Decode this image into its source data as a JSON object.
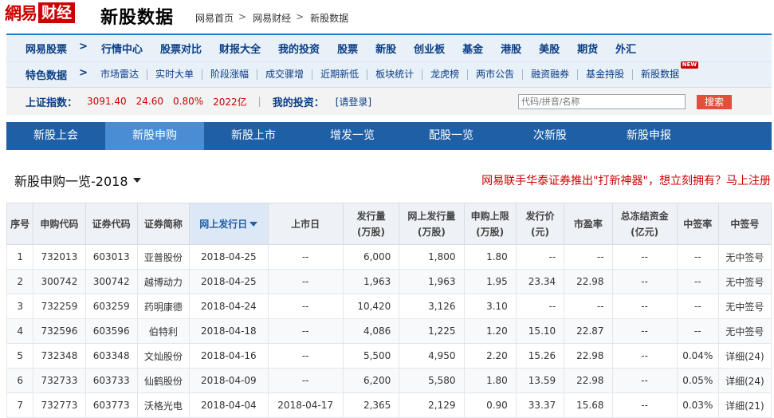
{
  "header": {
    "logo_part1": "網易",
    "logo_part2": "财经",
    "page_title": "新股数据",
    "breadcrumb": [
      "网易首页",
      "网易财经",
      "新股数据"
    ]
  },
  "nav": {
    "row1_lead": "网易股票",
    "row1_items": [
      "行情中心",
      "股票对比",
      "财报大全",
      "我的投资",
      "股票",
      "新股",
      "创业板",
      "基金",
      "港股",
      "美股",
      "期货",
      "外汇"
    ],
    "row2_lead": "特色数据",
    "row2_items": [
      "市场雷达",
      "实时大单",
      "阶段涨幅",
      "成交骤增",
      "近期新低",
      "板块统计",
      "龙虎榜",
      "两市公告",
      "融资融券",
      "基金持股",
      "新股数据"
    ],
    "new_badge": "NEW",
    "chevron": ">"
  },
  "index_bar": {
    "label": "上证指数：",
    "value": "3091.40",
    "change": "24.60",
    "pct": "0.80%",
    "volume": "2022亿",
    "divider": "|",
    "my_invest_label": "我的投资：",
    "login_link": "[请登录]",
    "search_placeholder": "代码/拼音/名称",
    "search_button": "搜索"
  },
  "tabs": [
    "新股上会",
    "新股申购",
    "新股上市",
    "增发一览",
    "配股一览",
    "次新股",
    "新股申报"
  ],
  "active_tab": 1,
  "section": {
    "title": "新股申购一览-2018",
    "promo": "网易联手华泰证券推出\"打新神器\"，想立刻拥有？马上注册"
  },
  "table": {
    "headers": [
      "序号",
      "申购代码",
      "证券代码",
      "证券简称",
      "网上发行日",
      "上市日",
      "发行量\n(万股)",
      "网上发行量\n(万股)",
      "申购上限\n(万股)",
      "发行价\n(元)",
      "市盈率",
      "总冻结资金\n(亿元)",
      "中签率",
      "中签号"
    ],
    "rows": [
      [
        "1",
        "732013",
        "603013",
        "亚普股份",
        "2018-04-25",
        "--",
        "6,000",
        "1,800",
        "1.80",
        "--",
        "--",
        "--",
        "--",
        "无中签号"
      ],
      [
        "2",
        "300742",
        "300742",
        "越博动力",
        "2018-04-25",
        "--",
        "1,963",
        "1,963",
        "1.95",
        "23.34",
        "22.98",
        "--",
        "--",
        "无中签号"
      ],
      [
        "3",
        "732259",
        "603259",
        "药明康德",
        "2018-04-24",
        "--",
        "10,420",
        "3,126",
        "3.10",
        "--",
        "--",
        "--",
        "--",
        "无中签号"
      ],
      [
        "4",
        "732596",
        "603596",
        "伯特利",
        "2018-04-18",
        "--",
        "4,086",
        "1,225",
        "1.20",
        "15.10",
        "22.87",
        "--",
        "--",
        "无中签号"
      ],
      [
        "5",
        "732348",
        "603348",
        "文灿股份",
        "2018-04-16",
        "--",
        "5,500",
        "4,950",
        "2.20",
        "15.26",
        "22.98",
        "--",
        "0.04%",
        "详细(24)"
      ],
      [
        "6",
        "732733",
        "603733",
        "仙鹤股份",
        "2018-04-09",
        "--",
        "6,200",
        "5,580",
        "1.80",
        "13.59",
        "22.98",
        "--",
        "0.05%",
        "详细(24)"
      ],
      [
        "7",
        "732773",
        "603773",
        "沃格光电",
        "2018-04-04",
        "2018-04-17",
        "2,365",
        "2,129",
        "0.90",
        "33.37",
        "15.68",
        "--",
        "0.03%",
        "详细(21)"
      ]
    ]
  }
}
